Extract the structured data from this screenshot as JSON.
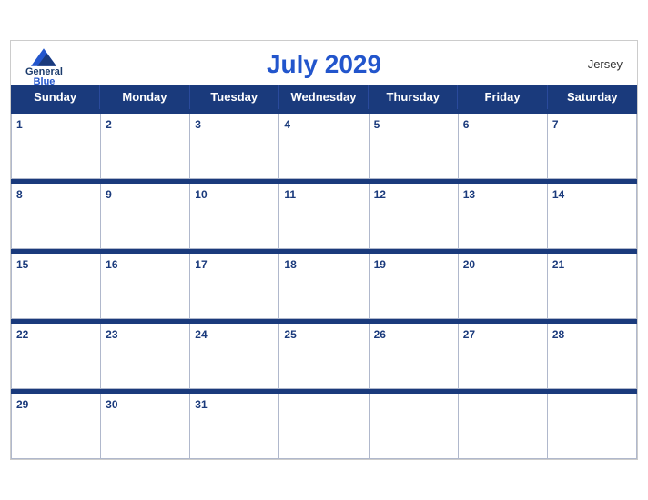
{
  "calendar": {
    "title": "July 2029",
    "region": "Jersey",
    "days_of_week": [
      "Sunday",
      "Monday",
      "Tuesday",
      "Wednesday",
      "Thursday",
      "Friday",
      "Saturday"
    ],
    "weeks": [
      [
        1,
        2,
        3,
        4,
        5,
        6,
        7
      ],
      [
        8,
        9,
        10,
        11,
        12,
        13,
        14
      ],
      [
        15,
        16,
        17,
        18,
        19,
        20,
        21
      ],
      [
        22,
        23,
        24,
        25,
        26,
        27,
        28
      ],
      [
        29,
        30,
        31,
        null,
        null,
        null,
        null
      ]
    ]
  },
  "logo": {
    "general": "General",
    "blue": "Blue"
  }
}
